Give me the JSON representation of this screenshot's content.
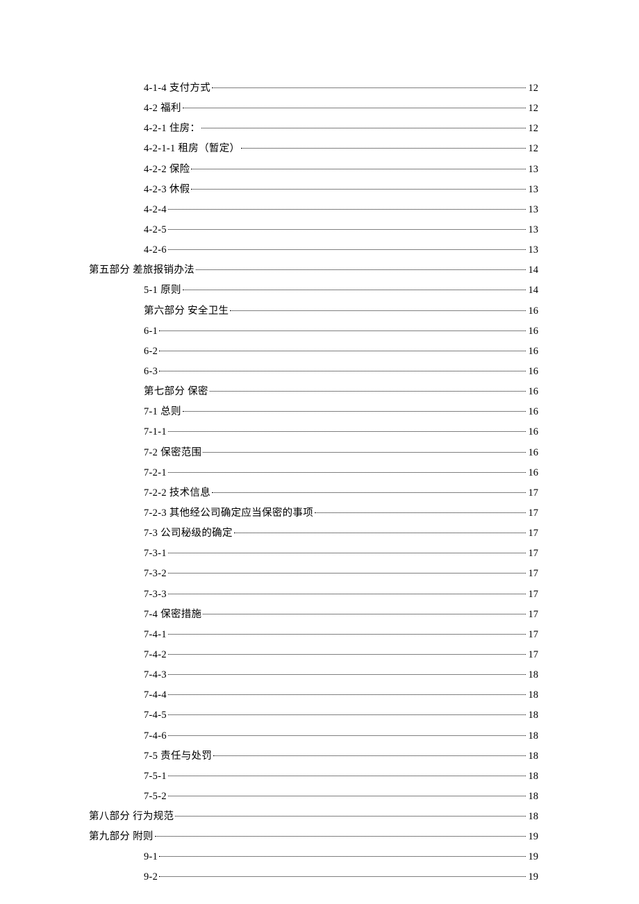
{
  "toc": [
    {
      "level": 3,
      "label": "4-1-4 支付方式",
      "page": "12"
    },
    {
      "level": 3,
      "label": "4-2 福利",
      "page": "12"
    },
    {
      "level": 3,
      "label": "4-2-1 住房：",
      "page": "12"
    },
    {
      "level": 3,
      "label": "4-2-1-1  租房（暂定）",
      "page": "12"
    },
    {
      "level": 3,
      "label": "4-2-2  保险",
      "page": "13"
    },
    {
      "level": 3,
      "label": "4-2-3  休假",
      "page": "13"
    },
    {
      "level": 3,
      "label": "4-2-4",
      "page": "13"
    },
    {
      "level": 3,
      "label": "4-2-5",
      "page": "13"
    },
    {
      "level": 3,
      "label": "4-2-6",
      "page": "13"
    },
    {
      "level": 1,
      "label": "第五部分  差旅报销办法",
      "page": "14"
    },
    {
      "level": 3,
      "label": "5-1  原则",
      "page": "14"
    },
    {
      "level": 3,
      "label": "第六部分  安全卫生",
      "page": "16"
    },
    {
      "level": 3,
      "label": "6-1",
      "page": "16"
    },
    {
      "level": 3,
      "label": "6-2",
      "page": "16"
    },
    {
      "level": 3,
      "label": "6-3",
      "page": "16"
    },
    {
      "level": 3,
      "label": "第七部分  保密",
      "page": "16"
    },
    {
      "level": 3,
      "label": "7-1 总则",
      "page": "16"
    },
    {
      "level": 3,
      "label": "7-1-1",
      "page": "16"
    },
    {
      "level": 3,
      "label": "7-2 保密范围",
      "page": "16"
    },
    {
      "level": 3,
      "label": "7-2-1",
      "page": "16"
    },
    {
      "level": 3,
      "label": "7-2-2 技术信息",
      "page": "17"
    },
    {
      "level": 3,
      "label": "7-2-3 其他经公司确定应当保密的事项",
      "page": "17"
    },
    {
      "level": 3,
      "label": "7-3 公司秘级的确定",
      "page": "17"
    },
    {
      "level": 3,
      "label": "7-3-1",
      "page": "17"
    },
    {
      "level": 3,
      "label": "7-3-2",
      "page": "17"
    },
    {
      "level": 3,
      "label": "7-3-3",
      "page": "17"
    },
    {
      "level": 3,
      "label": "7-4 保密措施",
      "page": "17"
    },
    {
      "level": 3,
      "label": "7-4-1",
      "page": "17"
    },
    {
      "level": 3,
      "label": "7-4-2",
      "page": "17"
    },
    {
      "level": 3,
      "label": "7-4-3",
      "page": "18"
    },
    {
      "level": 3,
      "label": "7-4-4",
      "page": "18"
    },
    {
      "level": 3,
      "label": "7-4-5",
      "page": "18"
    },
    {
      "level": 3,
      "label": "7-4-6",
      "page": "18"
    },
    {
      "level": 3,
      "label": "7-5 责任与处罚",
      "page": "18"
    },
    {
      "level": 3,
      "label": "7-5-1",
      "page": "18"
    },
    {
      "level": 3,
      "label": "7-5-2",
      "page": "18"
    },
    {
      "level": 1,
      "label": "第八部分  行为规范",
      "page": "18"
    },
    {
      "level": 1,
      "label": "第九部分  附则",
      "page": "19"
    },
    {
      "level": 3,
      "label": "9-1",
      "page": "19"
    },
    {
      "level": 3,
      "label": "9-2",
      "page": "19"
    }
  ]
}
